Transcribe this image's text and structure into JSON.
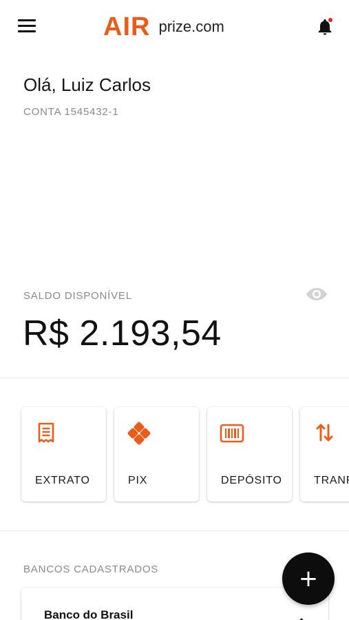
{
  "header": {
    "logo_air": "AIR",
    "logo_prize": "prize.com",
    "notification_dot_color": "#e0202a",
    "icons": {
      "menu": "menu-icon",
      "bell": "bell-icon"
    }
  },
  "greeting": {
    "text": "Olá, Luiz Carlos",
    "account": "CONTA 1545432-1"
  },
  "balance": {
    "label": "SALDO DISPONÍVEL",
    "value": "R$ 2.193,54",
    "visibility_icon": "eye-icon"
  },
  "actions": [
    {
      "label": "EXTRATO",
      "icon": "receipt-icon"
    },
    {
      "label": "PIX",
      "icon": "pix-icon"
    },
    {
      "label": "DEPÓSITO",
      "icon": "barcode-icon"
    },
    {
      "label": "TRANF",
      "icon": "transfer-arrows-icon"
    }
  ],
  "banks": {
    "label": "BANCOS CADASTRADOS",
    "items": [
      {
        "name": "Banco do Brasil"
      }
    ]
  },
  "fab": {
    "label": "+",
    "icon": "plus-icon"
  },
  "colors": {
    "accent": "#e85d1c",
    "text": "#111111",
    "muted": "#8a8a8a",
    "fab": "#0d0d0d"
  }
}
